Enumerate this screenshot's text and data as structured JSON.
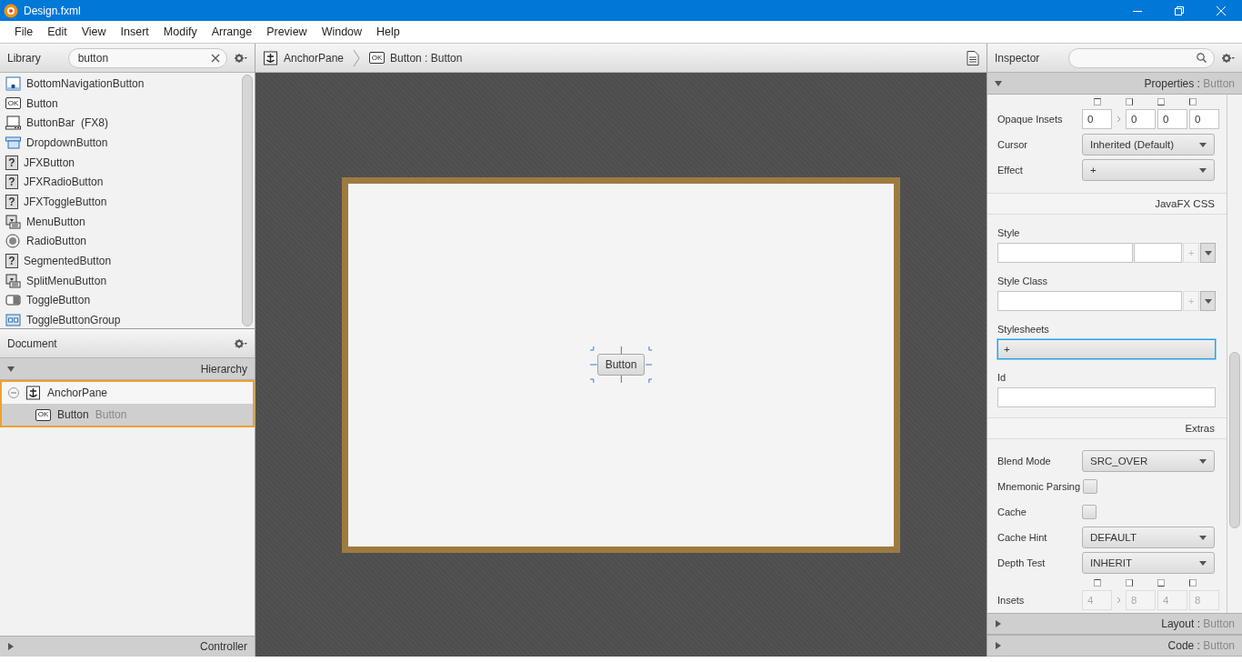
{
  "window": {
    "title": "Design.fxml"
  },
  "menu": [
    "File",
    "Edit",
    "View",
    "Insert",
    "Modify",
    "Arrange",
    "Preview",
    "Window",
    "Help"
  ],
  "library": {
    "title": "Library",
    "search": {
      "value": "button"
    },
    "items": [
      {
        "label": "BottomNavigationButton",
        "kind": "navigation"
      },
      {
        "label": "Button",
        "kind": "button",
        "icon_text": "OK"
      },
      {
        "label": "ButtonBar  (FX8)",
        "kind": "bar"
      },
      {
        "label": "DropdownButton",
        "kind": "dropdown"
      },
      {
        "label": "JFXButton",
        "kind": "unknown",
        "icon_text": "?"
      },
      {
        "label": "JFXRadioButton",
        "kind": "unknown",
        "icon_text": "?"
      },
      {
        "label": "JFXToggleButton",
        "kind": "unknown",
        "icon_text": "?"
      },
      {
        "label": "MenuButton",
        "kind": "menu"
      },
      {
        "label": "RadioButton",
        "kind": "radio"
      },
      {
        "label": "SegmentedButton",
        "kind": "unknown",
        "icon_text": "?"
      },
      {
        "label": "SplitMenuButton",
        "kind": "menu"
      },
      {
        "label": "ToggleButton",
        "kind": "toggle"
      },
      {
        "label": "ToggleButtonGroup",
        "kind": "group"
      }
    ]
  },
  "document": {
    "title": "Document",
    "section": {
      "title": "Hierarchy",
      "expanded": true
    },
    "tree": [
      {
        "label": "AnchorPane",
        "kind": "anchor",
        "expanded": true,
        "selected": false,
        "children": [
          {
            "label": "Button",
            "type": "Button",
            "kind": "button",
            "icon_text": "OK",
            "selected": true
          }
        ]
      }
    ],
    "controller": {
      "title": "Controller",
      "expanded": false
    }
  },
  "breadcrumb": [
    {
      "label": "AnchorPane",
      "kind": "anchor"
    },
    {
      "label": "Button : Button",
      "kind": "button",
      "icon_text": "OK"
    }
  ],
  "canvas": {
    "button_label": "Button"
  },
  "inspector": {
    "title": "Inspector",
    "sections": [
      {
        "title": "Properties :",
        "target": "Button",
        "expanded": true,
        "rows": [
          {
            "kind": "insets",
            "label": "Opaque Insets",
            "values": [
              "0",
              "0",
              "0",
              "0"
            ],
            "disabled": false
          },
          {
            "kind": "dropdown",
            "label": "Cursor",
            "value": "Inherited (Default)"
          },
          {
            "kind": "dropdown",
            "label": "Effect",
            "value": "+"
          },
          {
            "kind": "subheader",
            "label": "JavaFX CSS"
          },
          {
            "kind": "style",
            "label": "Style",
            "button_text": "+"
          },
          {
            "kind": "class",
            "label": "Style Class",
            "button_text": "+"
          },
          {
            "kind": "list",
            "label": "Stylesheets",
            "value": "+",
            "focused": true
          },
          {
            "kind": "text",
            "label": "Id"
          },
          {
            "kind": "subheader",
            "label": "Extras"
          },
          {
            "kind": "dropdown",
            "label": "Blend Mode",
            "value": "SRC_OVER"
          },
          {
            "kind": "checkbox",
            "label": "Mnemonic Parsing",
            "checked": false
          },
          {
            "kind": "checkbox",
            "label": "Cache",
            "checked": false
          },
          {
            "kind": "dropdown",
            "label": "Cache Hint",
            "value": "DEFAULT"
          },
          {
            "kind": "dropdown",
            "label": "Depth Test",
            "value": "INHERIT"
          },
          {
            "kind": "insets",
            "label": "Insets",
            "values": [
              "4",
              "8",
              "4",
              "8"
            ],
            "disabled": true
          }
        ]
      },
      {
        "title": "Layout :",
        "target": "Button",
        "expanded": false
      },
      {
        "title": "Code :",
        "target": "Button",
        "expanded": false
      }
    ]
  }
}
